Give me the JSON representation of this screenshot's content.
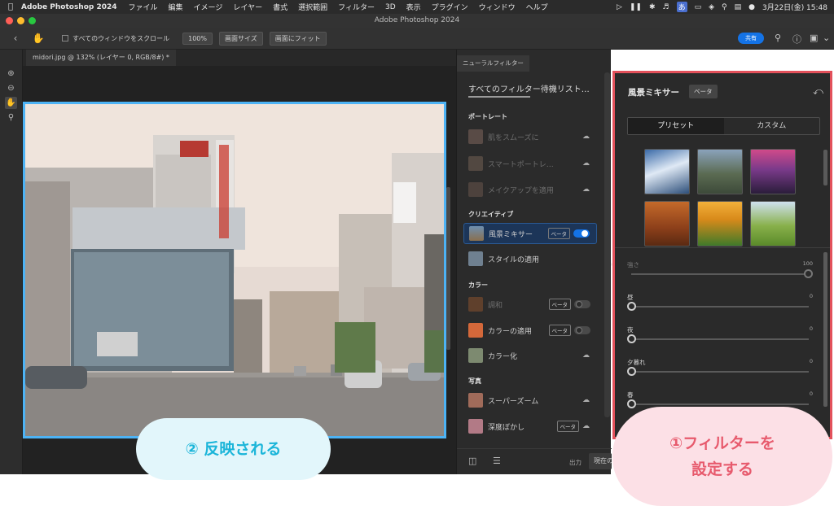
{
  "menubar": {
    "app_name": "Adobe Photoshop 2024",
    "items": [
      "ファイル",
      "編集",
      "イメージ",
      "レイヤー",
      "書式",
      "選択範囲",
      "フィルター",
      "3D",
      "表示",
      "プラグイン",
      "ウィンドウ",
      "ヘルプ"
    ],
    "input_method": "あ",
    "datetime": "3月22日(金)  15:48"
  },
  "titlebar": {
    "title": "Adobe Photoshop 2024"
  },
  "optionsbar": {
    "scroll_all_label": "すべてのウィンドウをスクロール",
    "zoom_label": "100%",
    "fit_screen_label": "画面サイズ",
    "fill_screen_label": "画面にフィット",
    "share_label": "共有"
  },
  "document": {
    "tab_label": "midori.jpg @ 132% (レイヤー 0, RGB/8#) *"
  },
  "filters_panel": {
    "tab_label": "ニューラルフィルター",
    "header": "すべてのフィルター待機リスト…",
    "categories": [
      {
        "title": "ポートレート",
        "items": [
          {
            "label": "肌をスムーズに",
            "state": "download"
          },
          {
            "label": "スマートポートレ…",
            "state": "download"
          },
          {
            "label": "メイクアップを適用",
            "state": "download"
          }
        ]
      },
      {
        "title": "クリエイティブ",
        "items": [
          {
            "label": "風景ミキサー",
            "badge": "ベータ",
            "state": "on"
          },
          {
            "label": "スタイルの適用",
            "state": "none"
          }
        ]
      },
      {
        "title": "カラー",
        "items": [
          {
            "label": "調和",
            "badge": "ベータ",
            "state": "off"
          },
          {
            "label": "カラーの適用",
            "badge": "ベータ",
            "state": "off"
          },
          {
            "label": "カラー化",
            "state": "download"
          }
        ]
      },
      {
        "title": "写真",
        "items": [
          {
            "label": "スーパーズーム",
            "state": "download"
          },
          {
            "label": "深度ぼかし",
            "badge": "ベータ",
            "state": "download"
          }
        ]
      }
    ],
    "footer": {
      "output_label": "出力",
      "output_value": "現在の"
    }
  },
  "filter_detail": {
    "title": "風景ミキサー",
    "badge": "ベータ",
    "segments": [
      "プリセット",
      "カスタム"
    ],
    "active_segment": "プリセット",
    "preset_count": 6,
    "sliders": [
      {
        "label": "強さ",
        "value": "100",
        "fraction": 1.0,
        "enabled": false
      },
      {
        "label": "昼",
        "value": "0",
        "fraction": 0.0,
        "enabled": true
      },
      {
        "label": "夜",
        "value": "0",
        "fraction": 0.0,
        "enabled": true
      },
      {
        "label": "夕暮れ",
        "value": "0",
        "fraction": 0.0,
        "enabled": true
      },
      {
        "label": "春",
        "value": "0",
        "fraction": 0.0,
        "enabled": true
      }
    ]
  },
  "annotations": {
    "reflect_label": "② 反映される",
    "setup_label_line1": "①フィルターを",
    "setup_label_line2": "設定する",
    "accent_blue": "#4db3f5",
    "accent_red": "#e2505a"
  }
}
